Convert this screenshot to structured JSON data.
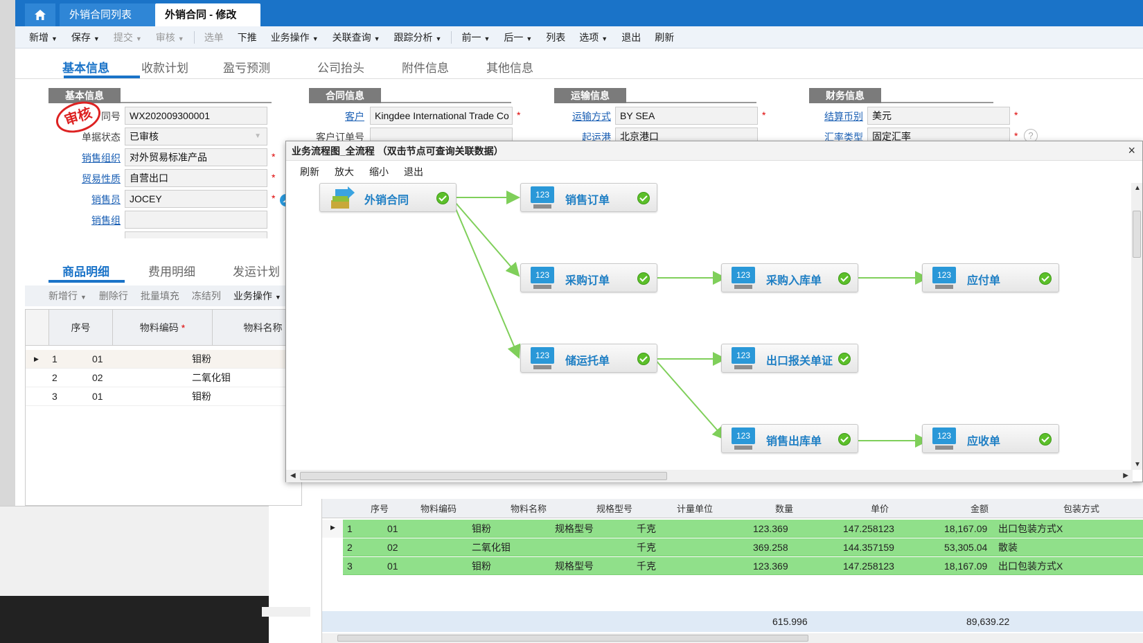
{
  "window_tabs": {
    "list_tab": "外销合同列表",
    "edit_tab": "外销合同 - 修改",
    "close_glyph": "×"
  },
  "toolbar": {
    "items": [
      "新增",
      "保存",
      "提交",
      "审核",
      "选单",
      "下推",
      "业务操作",
      "关联查询",
      "跟踪分析",
      "前一",
      "后一",
      "列表",
      "选项",
      "退出",
      "刷新"
    ]
  },
  "main_tabs": [
    "基本信息",
    "收款计划",
    "盈亏预测",
    "公司抬头",
    "附件信息",
    "其他信息"
  ],
  "sections": {
    "basic": "基本信息",
    "contract": "合同信息",
    "shipping": "运输信息",
    "finance": "财务信息"
  },
  "stamp_text": "审核",
  "basic_fields": {
    "contract_no_label": "同号",
    "contract_no": "WX202009300001",
    "status_label": "单据状态",
    "status": "已审核",
    "sales_org_label": "销售组织",
    "sales_org": "对外贸易标准产品",
    "trade_type_label": "贸易性质",
    "trade_type": "自营出口",
    "salesman_label": "销售员",
    "salesman": "JOCEY",
    "sales_group_label": "销售组",
    "sales_group": ""
  },
  "contract_fields": {
    "customer_label": "客户",
    "customer": "Kingdee International Trade Co",
    "customer_po_label": "客户订单号",
    "customer_po": ""
  },
  "shipping_fields": {
    "method_label": "运输方式",
    "method": "BY SEA",
    "port_label": "起运港",
    "port": "北京港口"
  },
  "finance_fields": {
    "currency_label": "结算币别",
    "currency": "美元",
    "rate_type_label": "汇率类型",
    "rate_type": "固定汇率"
  },
  "sub_tabs": [
    "商品明细",
    "费用明细",
    "发运计划"
  ],
  "sub_toolbar": [
    "新增行",
    "删除行",
    "批量填充",
    "冻结列",
    "业务操作"
  ],
  "left_grid": {
    "headers": [
      "序号",
      "物料编码",
      "物料名称"
    ],
    "rows": [
      {
        "no": "1",
        "code": "01",
        "name": "钼粉"
      },
      {
        "no": "2",
        "code": "02",
        "name": "二氧化钼"
      },
      {
        "no": "3",
        "code": "01",
        "name": "钼粉"
      }
    ]
  },
  "right_grid": {
    "headers": [
      "序号",
      "物料编码",
      "物料名称",
      "规格型号",
      "计量单位",
      "数量",
      "单价",
      "金额",
      "包装方式"
    ],
    "rows": [
      {
        "no": "1",
        "code": "01",
        "name": "钼粉",
        "spec": "规格型号",
        "unit": "千克",
        "qty": "123.369",
        "price": "147.258123",
        "amount": "18,167.09",
        "pack": "出口包装方式X"
      },
      {
        "no": "2",
        "code": "02",
        "name": "二氧化钼",
        "spec": "",
        "unit": "千克",
        "qty": "369.258",
        "price": "144.357159",
        "amount": "53,305.04",
        "pack": "散装"
      },
      {
        "no": "3",
        "code": "01",
        "name": "钼粉",
        "spec": "规格型号",
        "unit": "千克",
        "qty": "123.369",
        "price": "147.258123",
        "amount": "18,167.09",
        "pack": "出口包装方式X"
      }
    ],
    "total_qty": "615.996",
    "total_amount": "89,639.22"
  },
  "dialog": {
    "title": "业务流程图_全流程 （双击节点可查询关联数据）",
    "close_glyph": "×",
    "toolbar": [
      "刷新",
      "放大",
      "缩小",
      "退出"
    ],
    "nodes": {
      "contract": "外销合同",
      "sales_order": "销售订单",
      "purchase_order": "采购订单",
      "purchase_receipt": "采购入库单",
      "payable": "应付单",
      "shipping_order": "储运托单",
      "customs_doc": "出口报关单证",
      "sales_delivery": "销售出库单",
      "receivable": "应收单"
    },
    "node_icon_text": "123"
  },
  "colors": {
    "accent": "#1a73c8",
    "link": "#1a5fb4",
    "row_highlight": "#90e08a",
    "flow_line": "#7fcf5a",
    "ok_green": "#5cbf2a"
  }
}
